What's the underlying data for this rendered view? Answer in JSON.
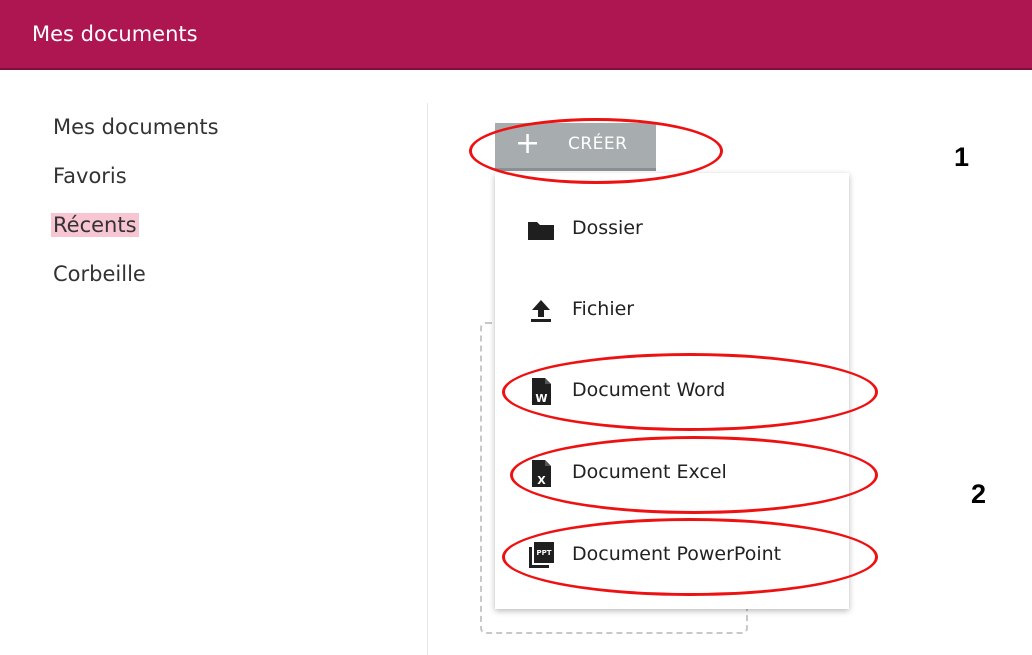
{
  "header": {
    "title": "Mes documents"
  },
  "sidebar": {
    "items": [
      {
        "label": "Mes documents"
      },
      {
        "label": "Favoris"
      },
      {
        "label": "Récents"
      },
      {
        "label": "Corbeille"
      }
    ],
    "active_item": "Récents"
  },
  "create_button": {
    "icon": "plus-icon",
    "label": "CRÉER"
  },
  "create_menu": {
    "items": [
      {
        "icon": "folder-icon",
        "label": "Dossier"
      },
      {
        "icon": "upload-icon",
        "label": "Fichier"
      },
      {
        "icon": "word-doc-icon",
        "label": "Document Word"
      },
      {
        "icon": "excel-doc-icon",
        "label": "Document Excel"
      },
      {
        "icon": "powerpoint-doc-icon",
        "label": "Document PowerPoint"
      }
    ]
  },
  "annotations": {
    "marker_1": "1",
    "marker_2": "2"
  },
  "colors": {
    "header_bg": "#ae1652",
    "active_highlight": "#f8c5d3",
    "button_bg": "#a7adaf",
    "annotation": "#ee1111"
  }
}
